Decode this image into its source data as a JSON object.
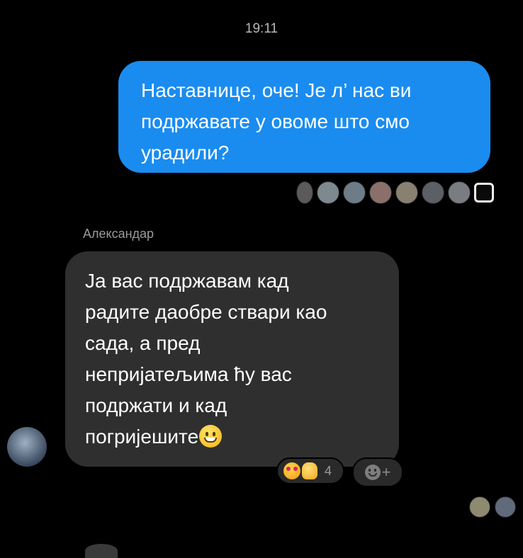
{
  "header": {
    "timestamp": "19:11"
  },
  "outgoing_message": {
    "lines": [
      "Наставнице, оче! Је л’ нас ви",
      "подржавате у овоме што смо",
      "урадили?"
    ],
    "bubble_color": "#1a8cf0"
  },
  "read_receipts_top": {
    "count": 8
  },
  "incoming_message": {
    "sender": "Александар",
    "lines": [
      "Ја вас подржавам кад",
      "радите даобре ствари као",
      "сада, а пред",
      "непријатељима ћу вас",
      "подржати и кад",
      "погријешите"
    ],
    "bubble_color": "#2f2f2f",
    "trailing_emoji": "grinning-face"
  },
  "reactions": {
    "emojis": [
      "heart-eyes-face",
      "thumbs-up"
    ],
    "count": "4"
  },
  "add_reaction": {
    "label": "+"
  },
  "read_receipts_bottom": {
    "count": 2
  }
}
